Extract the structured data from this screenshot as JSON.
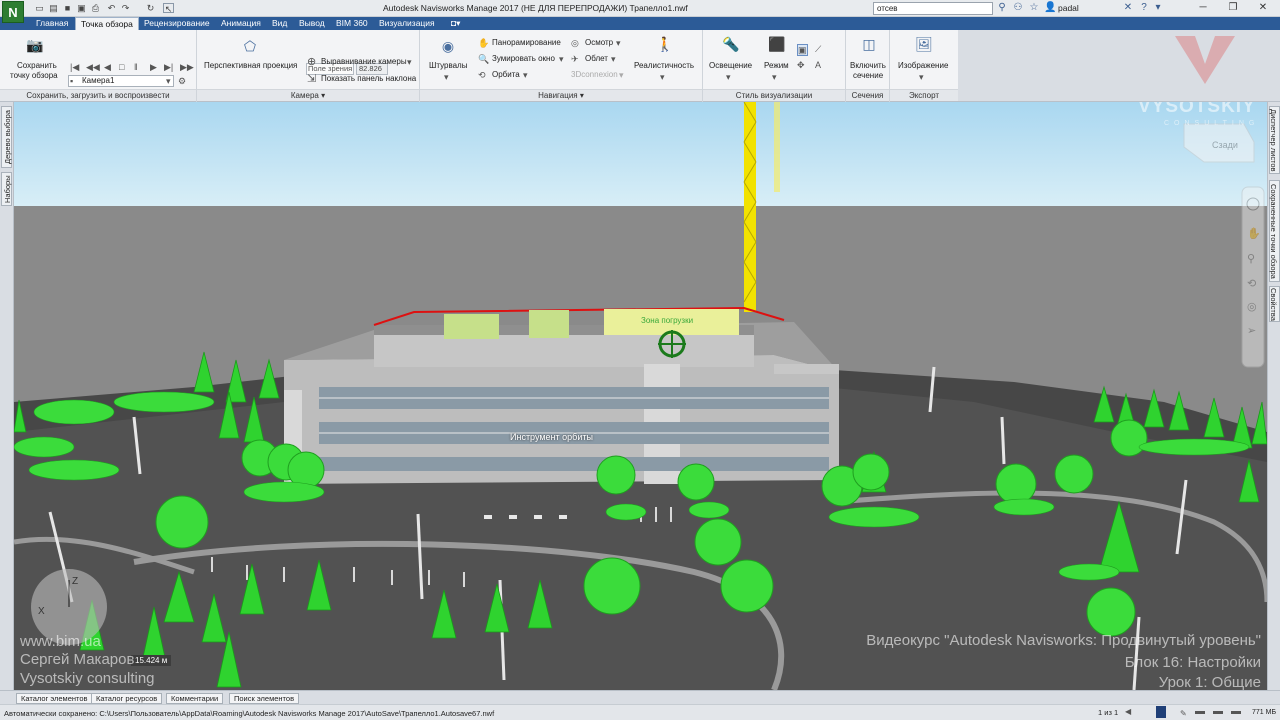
{
  "titlebar": {
    "app_letter": "N",
    "title": "Autodesk Navisworks Manage 2017 (НЕ ДЛЯ ПЕРЕПРОДАЖИ)    Трапелло1.nwf",
    "search_value": "отсев",
    "user": "padal"
  },
  "tabs": [
    "Главная",
    "Точка обзора",
    "Рецензирование",
    "Анимация",
    "Вид",
    "Вывод",
    "BIM 360",
    "Визуализация"
  ],
  "ribbon": {
    "save_viewpoint": [
      "Сохранить",
      "точку обзора"
    ],
    "camera_select": "Камера1",
    "perspective": "Перспективная проекция",
    "field_of_view_label": "Поле зрения",
    "field_of_view_value": "82.826",
    "align_camera": "Выравнивание камеры",
    "show_tilt": "Показать панель наклона",
    "steering": "Штурвалы",
    "pan": "Панорамирование",
    "zoom_window": "Зумировать окно",
    "orbit": "Орбита",
    "look": "Осмотр",
    "fly": "Облет",
    "connexion": "3Dconnexion",
    "realism": "Реалистичность",
    "lighting": "Освещение",
    "mode": "Режим",
    "enable_section": [
      "Включить",
      "сечение"
    ],
    "image": "Изображение",
    "panels": {
      "save": "Сохранить, загрузить и воспроизвести",
      "camera": "Камера",
      "navigation": "Навигация",
      "render_style": "Стиль визуализации",
      "sections": "Сечения",
      "export": "Экспорт"
    }
  },
  "left_dock": [
    "Дерево выбора",
    "Наборы"
  ],
  "right_dock": [
    "Диспетчер листов",
    "Сохраненные точки обзора",
    "Свойства"
  ],
  "viewport": {
    "tooltip": "Инструмент орбиты",
    "scale": "15.424 м",
    "zone_label": "Зона погрузки",
    "viewcube": "Сзади"
  },
  "watermark": {
    "brand": "VYSOTSKIY",
    "brand_sub": "CONSULTING",
    "site": "www.bim.ua",
    "author": "Сергей Макаров",
    "company": "Vysotskiy consulting",
    "course": "Видеокурс \"Autodesk Navisworks: Продвинутый уровень\"",
    "block": "Блок 16: Настройки",
    "lesson": "Урок 1: Общие"
  },
  "bottom_tabs": [
    "Каталог элементов",
    "Каталог ресурсов",
    "Комментарии",
    "Поиск элементов"
  ],
  "status": {
    "autosave": "Автоматически сохранено: C:\\Users\\Пользователь\\AppData\\Roaming\\Autodesk Navisworks Manage 2017\\AutoSave\\Трапелло1.Autosave67.nwf",
    "page": "1 из 1",
    "memory": "771 МБ"
  },
  "colors": {
    "accent": "#2c5b97",
    "sky": "#c3e2f2",
    "tree": "#2fd32f",
    "crane": "#f2e200"
  }
}
